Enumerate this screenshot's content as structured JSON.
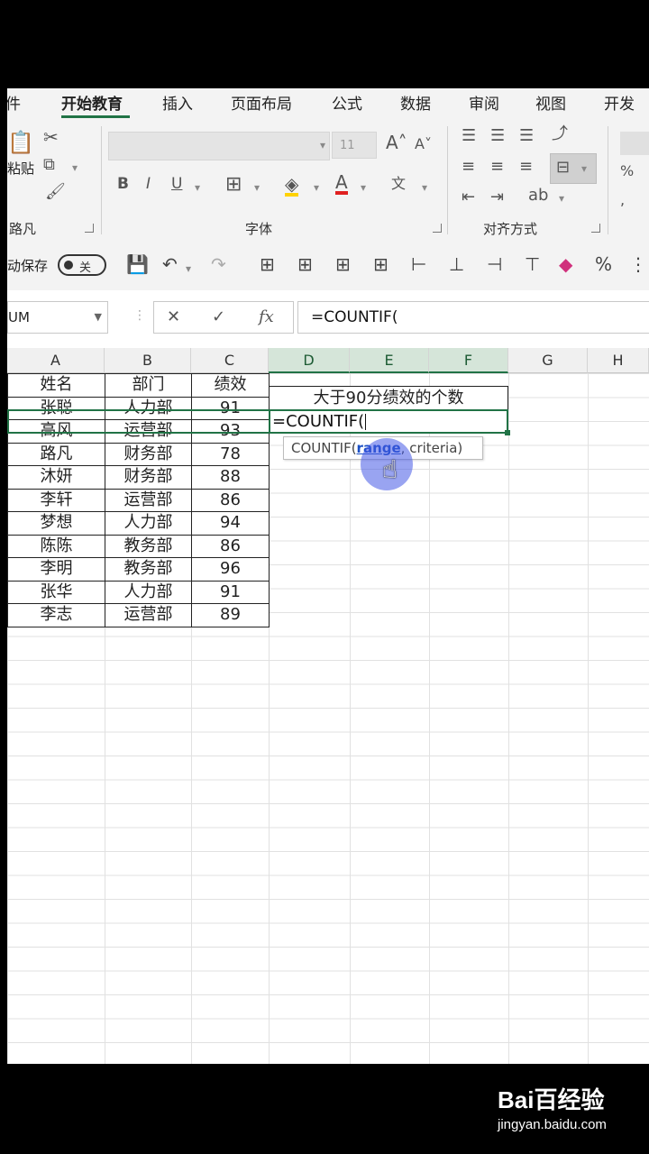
{
  "ribbon": {
    "tabs": [
      "文件",
      "开始教育",
      "插入",
      "页面布局",
      "公式",
      "数据",
      "审阅",
      "视图",
      "开发工具"
    ],
    "tab_partial_left": "件",
    "tab_partial_right": "开发",
    "groups": {
      "clipboard": "路凡",
      "font": "字体",
      "alignment": "对齐方式"
    },
    "font_size": "11",
    "paste_label": "粘贴",
    "accent_color": "#217346"
  },
  "qat": {
    "autosave_label": "动保存",
    "toggle_text": "关"
  },
  "formula_bar": {
    "name_box": "UM",
    "cancel": "✕",
    "enter": "✓",
    "fx": "fx",
    "formula": "=COUNTIF("
  },
  "columns": [
    "A",
    "B",
    "C",
    "D",
    "E",
    "F",
    "G",
    "H"
  ],
  "table": {
    "headers": [
      "姓名",
      "部门",
      "绩效"
    ],
    "rows": [
      [
        "张聪",
        "人力部",
        "91"
      ],
      [
        "高风",
        "运营部",
        "93"
      ],
      [
        "路凡",
        "财务部",
        "78"
      ],
      [
        "沐妍",
        "财务部",
        "88"
      ],
      [
        "李轩",
        "运营部",
        "86"
      ],
      [
        "梦想",
        "人力部",
        "94"
      ],
      [
        "陈陈",
        "教务部",
        "86"
      ],
      [
        "李明",
        "教务部",
        "96"
      ],
      [
        "张华",
        "人力部",
        "91"
      ],
      [
        "李志",
        "运营部",
        "89"
      ]
    ]
  },
  "summary_title": "大于90分绩效的个数",
  "active_cell_text": "=COUNTIF(",
  "tooltip": {
    "fn": "COUNTIF(",
    "arg1": "range",
    "rest": ", criteria)"
  },
  "watermark": {
    "logo": "Bai百经验",
    "url": "jingyan.baidu.com"
  }
}
